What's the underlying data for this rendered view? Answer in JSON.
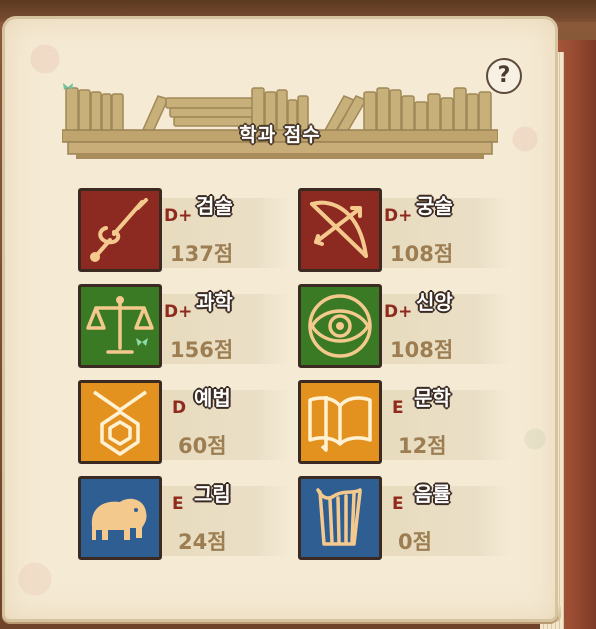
{
  "header": {
    "title": "학과 점수",
    "help_label": "?"
  },
  "colors": {
    "red_tile": "#8c2a22",
    "green_tile": "#3a7a24",
    "orange_tile": "#e3921f",
    "blue_tile": "#2f5e93",
    "grade_text": "#8f2a1e",
    "score_text": "#9c7e52"
  },
  "subjects": [
    {
      "name": "검술",
      "grade": "D+",
      "score": "137점",
      "icon": "sword-icon"
    },
    {
      "name": "궁술",
      "grade": "D+",
      "score": "108점",
      "icon": "bow-icon"
    },
    {
      "name": "과학",
      "grade": "D+",
      "score": "156점",
      "icon": "scales-icon"
    },
    {
      "name": "신앙",
      "grade": "D+",
      "score": "108점",
      "icon": "eye-icon"
    },
    {
      "name": "예법",
      "grade": "D",
      "score": "60점",
      "icon": "pendant-icon"
    },
    {
      "name": "문학",
      "grade": "E",
      "score": "12점",
      "icon": "book-icon"
    },
    {
      "name": "그림",
      "grade": "E",
      "score": "24점",
      "icon": "elephant-icon"
    },
    {
      "name": "음률",
      "grade": "E",
      "score": "0점",
      "icon": "harp-icon"
    }
  ]
}
